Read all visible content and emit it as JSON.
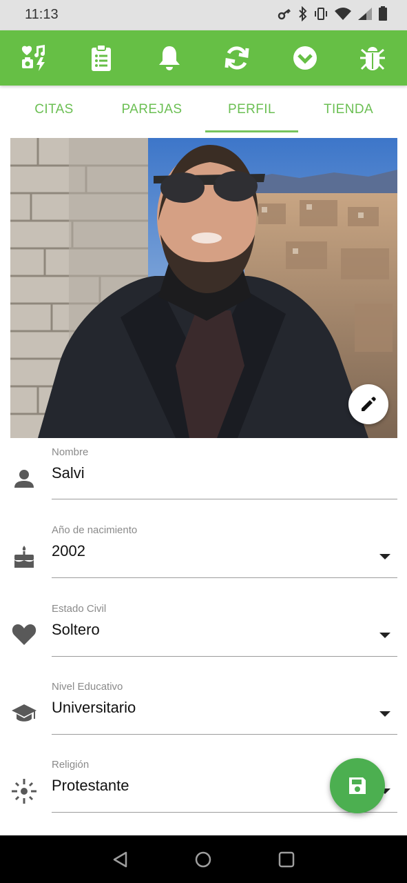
{
  "status_bar": {
    "time": "11:13",
    "icons": [
      "vpn-key-icon",
      "bluetooth-icon",
      "vibrate-icon",
      "wifi-icon",
      "signal-icon",
      "battery-icon"
    ]
  },
  "toolbar": {
    "icons": [
      "hearts-photo-icon",
      "clipboard-list-icon",
      "bell-icon",
      "sync-icon",
      "chevron-circle-down-icon",
      "bug-icon"
    ],
    "background": "#66bf45"
  },
  "tabs": {
    "items": [
      {
        "label": "CITAS"
      },
      {
        "label": "PAREJAS"
      },
      {
        "label": "PERFIL"
      },
      {
        "label": "TIENDA"
      }
    ],
    "active_index": 2,
    "color": "#6bbf53"
  },
  "profile_photo": {
    "edit_icon": "pencil-icon"
  },
  "form": {
    "nombre": {
      "label": "Nombre",
      "value": "Salvi",
      "icon": "person-icon"
    },
    "nacimiento": {
      "label": "Año de nacimiento",
      "value": "2002",
      "icon": "cake-icon"
    },
    "estado_civil": {
      "label": "Estado Civil",
      "value": "Soltero",
      "icon": "heart-icon"
    },
    "nivel_educativo": {
      "label": "Nivel Educativo",
      "value": "Universitario",
      "icon": "graduation-cap-icon"
    },
    "religion": {
      "label": "Religión",
      "value": "Protestante",
      "icon": "sun-icon"
    }
  },
  "save_button": {
    "icon": "floppy-disk-icon",
    "color": "#4caf50"
  },
  "nav_bar": {
    "icons": [
      "back-icon",
      "home-icon",
      "recents-icon"
    ]
  }
}
